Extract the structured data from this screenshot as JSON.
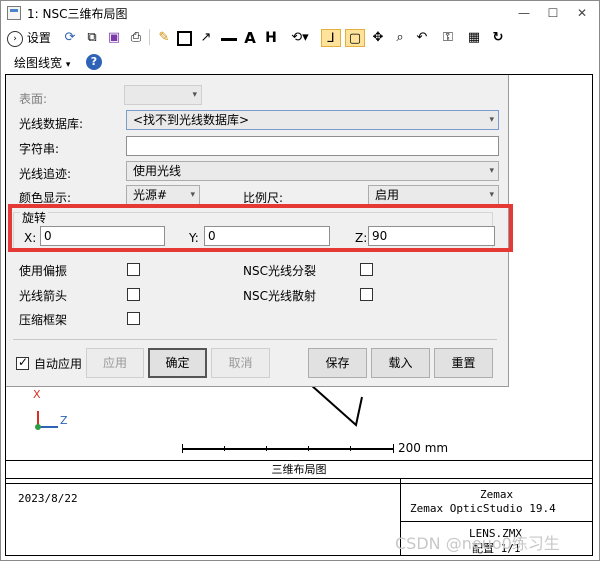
{
  "window": {
    "title": "1: NSC三维布局图",
    "min_glyph": "—",
    "max_glyph": "☐",
    "close_glyph": "✕"
  },
  "toolbar": {
    "settings_label": "设置",
    "icons": [
      "refresh-icon",
      "copy-icon",
      "save-icon",
      "print-icon",
      "pencil-icon",
      "rectangle-icon",
      "arrow-icon",
      "line-icon",
      "text-icon",
      "dimension-icon",
      "rotate-view-icon",
      "axes-icon",
      "zoom-fit-icon",
      "pan-icon",
      "zoom-icon",
      "undo-view-icon",
      "lock-icon",
      "frame-icon",
      "reload-icon"
    ]
  },
  "toolbar2": {
    "line_width_label": "绘图线宽",
    "line_width_arrow": "▾",
    "help_label": "?"
  },
  "settings_panel": {
    "surface_label": "表面:",
    "ray_database_label": "光线数据库:",
    "ray_database_value": "<找不到光线数据库>",
    "string_label": "字符串:",
    "string_value": "",
    "ray_trace_label": "光线追迹:",
    "ray_trace_value": "使用光线",
    "color_label": "颜色显示:",
    "color_value": "光源#",
    "scale_label": "比例尺:",
    "scale_value": "启用",
    "rotation": {
      "group_label": "旋转",
      "x_label": "X:",
      "x_value": "0",
      "y_label": "Y:",
      "y_value": "0",
      "z_label": "Z:",
      "z_value": "90"
    },
    "use_polarization_label": "使用偏振",
    "nsc_split_label": "NSC光线分裂",
    "ray_arrows_label": "光线箭头",
    "nsc_scatter_label": "NSC光线散射",
    "compress_frames_label": "压缩框架",
    "auto_apply_label": "自动应用",
    "auto_apply_checked": true,
    "buttons": {
      "apply": "应用",
      "ok": "确定",
      "cancel": "取消",
      "save": "保存",
      "load": "载入",
      "reset": "重置"
    }
  },
  "plot": {
    "axis_x_label": "X",
    "axis_z_label": "Z",
    "scale_bar_label": "200 mm"
  },
  "footer": {
    "title": "三维布局图",
    "date": "2023/8/22",
    "company": "Zemax",
    "product": "Zemax OpticStudio 19.4",
    "file": "LENS.ZMX",
    "config": "配置 1/1"
  },
  "watermark": "CSDN @neuo0练习生"
}
